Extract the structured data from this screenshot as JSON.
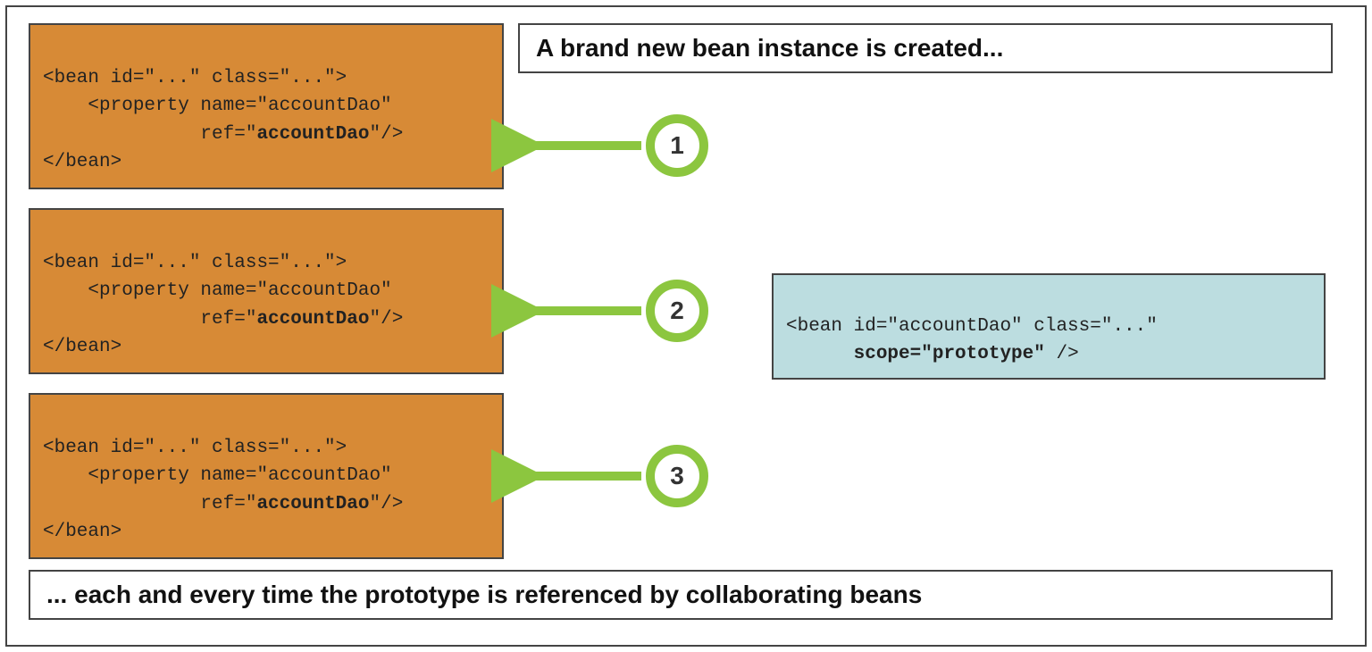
{
  "title_top": "A brand new bean instance is created...",
  "title_bottom": "... each and every time the prototype is referenced by collaborating beans",
  "bean_box": {
    "line1": "<bean id=\"...\" class=\"...\">",
    "line2_pre": "    <property name=\"accountDao\"",
    "line3_pre": "              ref=\"",
    "line3_bold": "accountDao",
    "line3_post": "\"/>",
    "line4": "</bean>"
  },
  "prototype_box": {
    "line1": "<bean id=\"accountDao\" class=\"...\"",
    "line2_pre": "      ",
    "line2_bold": "scope=\"prototype\"",
    "line2_post": " />"
  },
  "badges": [
    "1",
    "2",
    "3"
  ]
}
